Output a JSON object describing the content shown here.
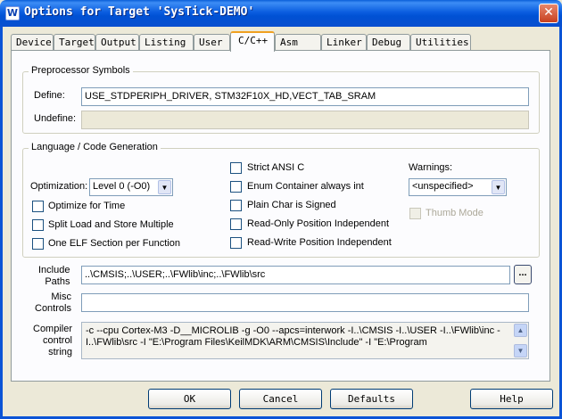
{
  "window": {
    "title": "Options for Target 'SysTick-DEMO'",
    "app_icon": "W",
    "close_glyph": "✕"
  },
  "tabs": [
    "Device",
    "Target",
    "Output",
    "Listing",
    "User",
    "C/C++",
    "Asm",
    "Linker",
    "Debug",
    "Utilities"
  ],
  "active_tab": "C/C++",
  "preprocessor": {
    "legend": "Preprocessor Symbols",
    "define_label": "Define:",
    "define_value": "USE_STDPERIPH_DRIVER, STM32F10X_HD,VECT_TAB_SRAM",
    "undefine_label": "Undefine:",
    "undefine_value": ""
  },
  "language": {
    "legend": "Language / Code Generation",
    "optimization_label": "Optimization:",
    "optimization_value": "Level 0 (-O0)",
    "optimize_for_time": "Optimize for Time",
    "split_load_store": "Split Load and Store Multiple",
    "one_elf_section": "One ELF Section per Function",
    "strict_ansi": "Strict ANSI C",
    "enum_container": "Enum Container always int",
    "plain_char_signed": "Plain Char is Signed",
    "ropi": "Read-Only Position Independent",
    "rwpi": "Read-Write Position Independent",
    "warnings_label": "Warnings:",
    "warnings_value": "<unspecified>",
    "thumb_mode": "Thumb Mode"
  },
  "include_paths": {
    "label_line1": "Include",
    "label_line2": "Paths",
    "value": "..\\CMSIS;..\\USER;..\\FWlib\\inc;..\\FWlib\\src",
    "browse": "..."
  },
  "misc_controls": {
    "label_line1": "Misc",
    "label_line2": "Controls",
    "value": ""
  },
  "compiler_control": {
    "label_line1": "Compiler",
    "label_line2": "control",
    "label_line3": "string",
    "line1": "-c --cpu Cortex-M3 -D__MICROLIB -g -O0 --apcs=interwork -I..\\CMSIS -I..\\USER -I..\\FWlib\\inc -",
    "line2": "I..\\FWlib\\src -I \"E:\\Program Files\\KeilMDK\\ARM\\CMSIS\\Include\" -I \"E:\\Program"
  },
  "buttons": {
    "ok": "OK",
    "cancel": "Cancel",
    "defaults": "Defaults",
    "help": "Help"
  }
}
